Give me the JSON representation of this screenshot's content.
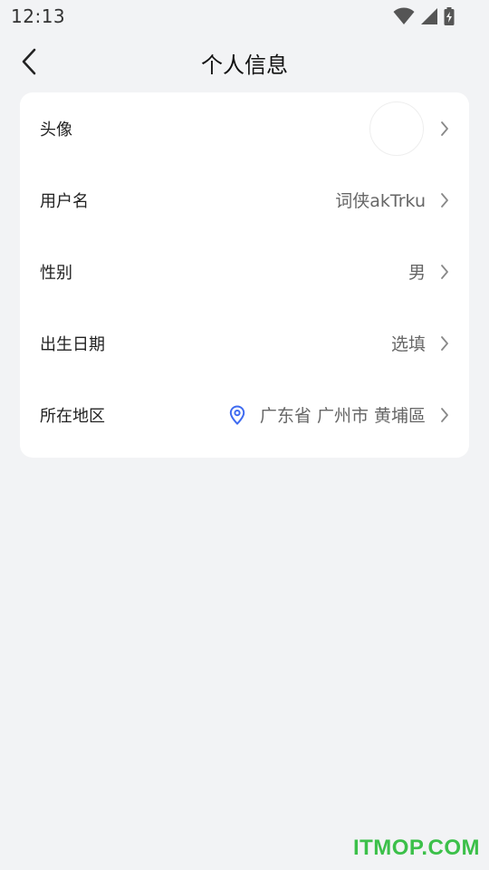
{
  "status_bar": {
    "time": "12:13",
    "icons": [
      "wifi-icon",
      "signal-icon",
      "battery-charging-icon"
    ]
  },
  "nav": {
    "title": "个人信息",
    "back_icon": "chevron-left-icon"
  },
  "rows": [
    {
      "label": "头像",
      "value": ""
    },
    {
      "label": "用户名",
      "value": "词侠akTrku"
    },
    {
      "label": "性别",
      "value": "男"
    },
    {
      "label": "出生日期",
      "value": "选填"
    },
    {
      "label": "所在地区",
      "value": "广东省 广州市 黄埔區"
    }
  ],
  "colors": {
    "background": "#f2f3f5",
    "card": "#ffffff",
    "location_icon": "#3f6bf0",
    "watermark": "#3cc04a"
  },
  "watermark": "ITMOP.COM"
}
